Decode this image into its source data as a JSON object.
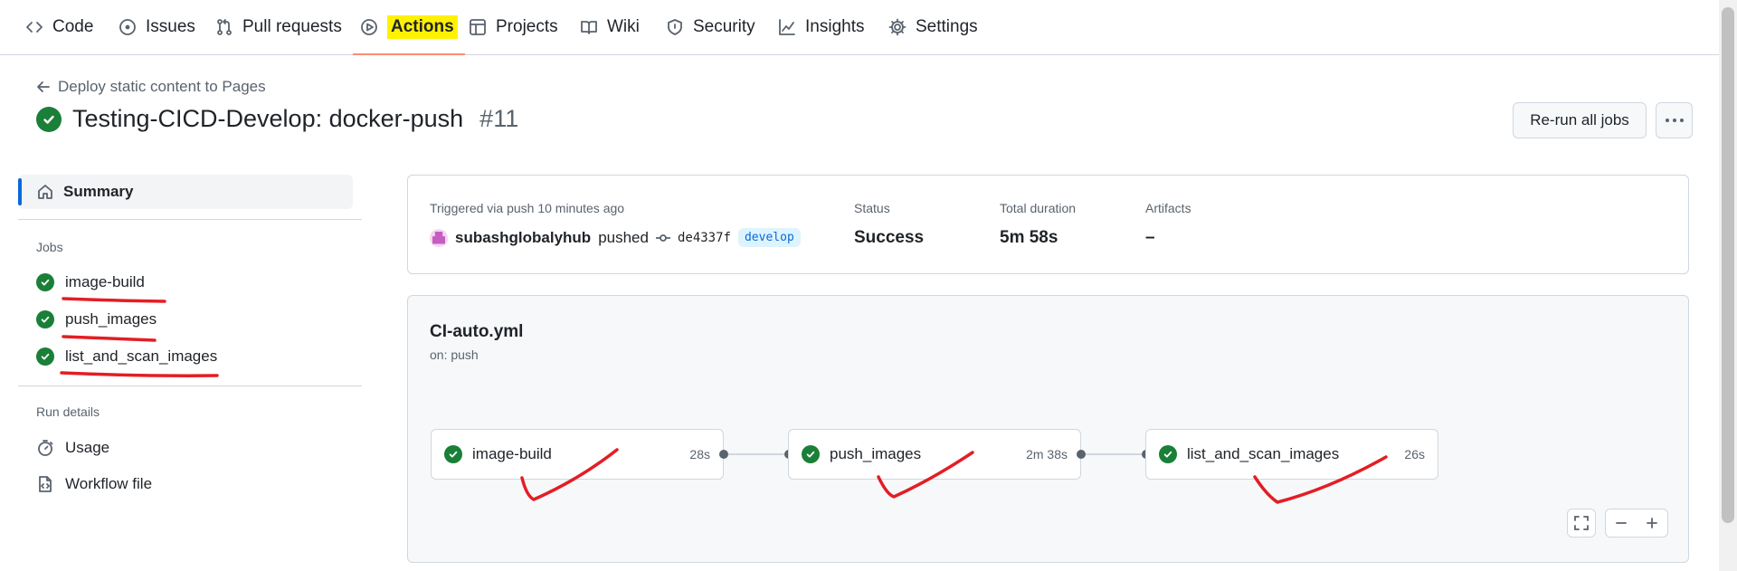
{
  "nav": {
    "items": [
      {
        "label": "Code",
        "icon": "code-icon"
      },
      {
        "label": "Issues",
        "icon": "issue-icon"
      },
      {
        "label": "Pull requests",
        "icon": "pull-request-icon"
      },
      {
        "label": "Actions",
        "icon": "play-icon",
        "active": true
      },
      {
        "label": "Projects",
        "icon": "table-icon"
      },
      {
        "label": "Wiki",
        "icon": "book-icon"
      },
      {
        "label": "Security",
        "icon": "shield-icon"
      },
      {
        "label": "Insights",
        "icon": "graph-icon"
      },
      {
        "label": "Settings",
        "icon": "gear-icon"
      }
    ]
  },
  "header": {
    "back_label": "Deploy static content to Pages",
    "title": "Testing-CICD-Develop: docker-push",
    "run_number": "#11",
    "rerun_label": "Re-run all jobs"
  },
  "sidebar": {
    "summary_label": "Summary",
    "jobs_heading": "Jobs",
    "jobs": [
      {
        "name": "image-build",
        "status": "success"
      },
      {
        "name": "push_images",
        "status": "success"
      },
      {
        "name": "list_and_scan_images",
        "status": "success"
      }
    ],
    "run_details_heading": "Run details",
    "usage_label": "Usage",
    "workflow_file_label": "Workflow file"
  },
  "run_info": {
    "trigger_text": "Triggered via push 10 minutes ago",
    "actor": "subashglobalyhub",
    "action": "pushed",
    "commit_sha": "de4337f",
    "branch": "develop",
    "status_label": "Status",
    "status_value": "Success",
    "duration_label": "Total duration",
    "duration_value": "5m 58s",
    "artifacts_label": "Artifacts",
    "artifacts_value": "–"
  },
  "workflow": {
    "file": "CI-auto.yml",
    "trigger": "on: push",
    "jobs": [
      {
        "name": "image-build",
        "duration": "28s"
      },
      {
        "name": "push_images",
        "duration": "2m 38s"
      },
      {
        "name": "list_and_scan_images",
        "duration": "26s"
      }
    ]
  },
  "colors": {
    "success": "#1a7f37",
    "accent": "#0969da",
    "highlight": "#fff200",
    "annotation": "#e31e24"
  }
}
